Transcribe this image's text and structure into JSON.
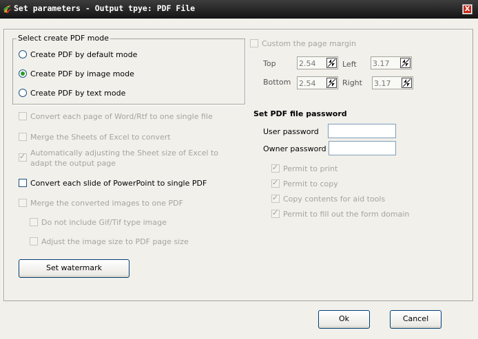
{
  "window": {
    "title": "Set parameters - Output tpye: PDF File",
    "close_label": "X"
  },
  "mode_group": {
    "title": "Select create PDF mode",
    "options": [
      {
        "label": "Create PDF by default mode",
        "selected": false
      },
      {
        "label": "Create PDF by image mode",
        "selected": true
      },
      {
        "label": "Create PDF by text mode",
        "selected": false
      }
    ]
  },
  "options": {
    "word_single": {
      "label": "Convert each page of Word/Rtf to one single file",
      "checked": false,
      "enabled": false
    },
    "merge_excel": {
      "label": "Merge the Sheets of Excel to convert",
      "checked": false,
      "enabled": false
    },
    "adjust_excel": {
      "label": "Automatically adjusting the Sheet size of Excel to adapt the output page",
      "checked": true,
      "enabled": false
    },
    "ppt_single": {
      "label": "Convert each slide of PowerPoint to single PDF",
      "checked": false,
      "enabled": true
    },
    "merge_images": {
      "label": "Merge the converted images to one PDF",
      "checked": false,
      "enabled": false
    },
    "no_gif": {
      "label": "Do not include Gif/Tif type image",
      "checked": false,
      "enabled": false
    },
    "adjust_image": {
      "label": "Adjust the image size to PDF page size",
      "checked": false,
      "enabled": false
    }
  },
  "watermark_button": "Set watermark",
  "margin": {
    "label": "Custom the page margin",
    "checked": false,
    "top": {
      "label": "Top",
      "value": "2.54"
    },
    "left": {
      "label": "Left",
      "value": "3.17"
    },
    "bottom": {
      "label": "Bottom",
      "value": "2.54"
    },
    "right": {
      "label": "Right",
      "value": "3.17"
    }
  },
  "password": {
    "title": "Set PDF file password",
    "user_label": "User password",
    "user_value": "",
    "owner_label": "Owner password",
    "owner_value": "",
    "permissions": [
      {
        "label": "Permit to print",
        "checked": true
      },
      {
        "label": "Permit to copy",
        "checked": true
      },
      {
        "label": "Copy contents for aid tools",
        "checked": true
      },
      {
        "label": "Permit to fill out the form domain",
        "checked": true
      }
    ]
  },
  "buttons": {
    "ok": "Ok",
    "cancel": "Cancel"
  }
}
